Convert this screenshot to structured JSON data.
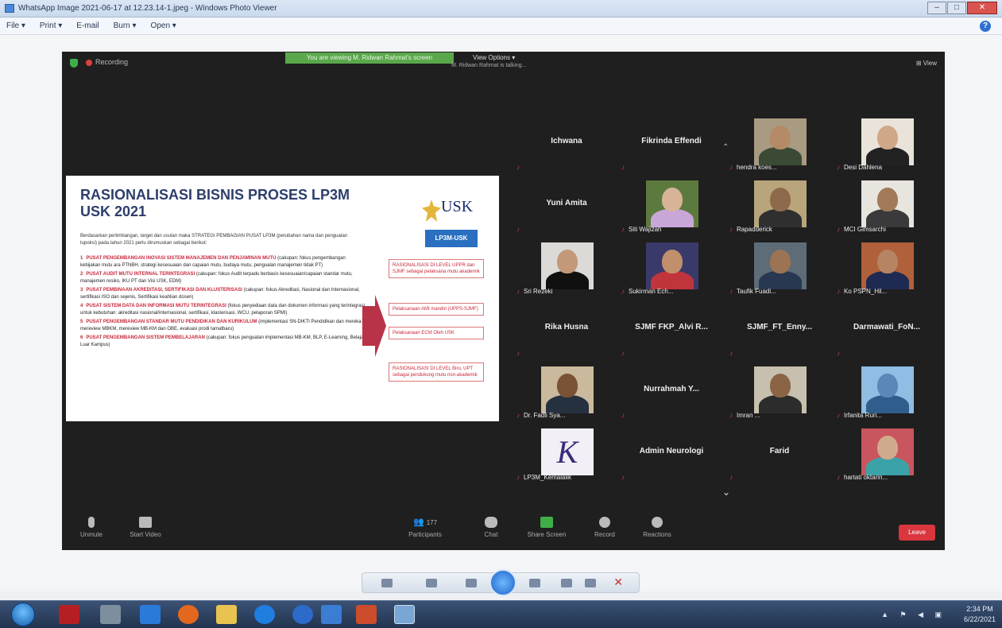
{
  "window": {
    "title": "WhatsApp Image 2021-06-17 at 12.23.14-1.jpeg - Windows Photo Viewer",
    "menu": [
      "File ▾",
      "Print ▾",
      "E-mail",
      "Burn ▾",
      "Open ▾"
    ],
    "help": "?"
  },
  "zoom": {
    "recording_label": "Recording",
    "viewing_banner": "You are viewing M. Ridwan Rahmat's screen",
    "view_options": "View Options ▾",
    "talking": "M. Ridwan Rahmat is talking...",
    "view_button": "View",
    "slide": {
      "title": "RASIONALISASI BISNIS PROSES LP3M USK 2021",
      "logo_text": "USK",
      "badge": "LP3M-USK",
      "intro": "Berdasarkan pertimbangan, target dan usulan maka STRATEGI PEMBAGIAN PUSAT LP3M (perubahan nama dan penguatan tupoksi) pada tahun 2021 perlu dirumuskan sebagai berikut:",
      "items": [
        {
          "num": "1",
          "head": "PUSAT PENGEMBANGAN INOVASI SISTEM MANAJEMEN DAN PENJAMINAN MUTU",
          "body": "(cakupan: fokus pengembangan kebijakan mutu ara PTNBH, strategi kesesuaian dan capaian mutu, budaya mutu, pengualan manajemen tidak PT)"
        },
        {
          "num": "2",
          "head": "PUSAT AUDIT MUTU INTERNAL TERINTEGRASI",
          "body": "(cakupan: fokus Audit terpadu berbasis kesesuaian/capaian standar mutu, manajemen resiko, IKU PT dan Visi USK, EDM)"
        },
        {
          "num": "3",
          "head": "PUSAT PEMBINAAN AKREDITASI, SERTIFIKASI DAN KLUSTERISASI",
          "body": "(cakupan: fokus Akreditasi, Nasional dan Internasional, sertifikasi ISO dan sejenis, Sertifikasi keahlian dosen)"
        },
        {
          "num": "4",
          "head": "PUSAT SISTEM DATA DAN INFORMASI MUTU TERINTEGRASI",
          "body": "(fokus penyediaan data dan dokumen informasi yang terintegrasi untuk kebutuhan: akreditasi nasional/internasional, sertifikasi, klasterisasi, WCU, pelaporan SPMI)"
        },
        {
          "num": "5",
          "head": "PUSAT PENGEMBANGAN STANDAR MUTU PENDIDIKAN DAN KURIKULUM",
          "body": "(implementasi SN-DIKTI Pendidikan dan mereka: mereview MBKM, mereview MB-KM dan OBE, evaluasi prodi tamatbaru)"
        },
        {
          "num": "6",
          "head": "PUSAT PENGEMBANGAN SISTEM PEMBELAJARAN",
          "body": "(cakupan: fokus penguatan implementasi MB-KM, BLP, E-Learning, Belajar Luar Kampus)"
        }
      ],
      "side_boxes": [
        "RASIONALISASI DI LEVEL UPPR dan SJMF sebagai pelaksana mutu akademik",
        "Pelaksanaan AMI mandiri (UPPS-SJMF)",
        "Pelaksanaan ECM Oleh USK",
        "RASIONALISASI DI LEVEL Biro, UPT sebagai pendukung mutu non-akademik"
      ]
    },
    "participants": [
      {
        "name": "Ichwana",
        "photo": false,
        "col": 0,
        "row": 0
      },
      {
        "name": "Fikrinda Effendi",
        "photo": false,
        "col": 1,
        "row": 0
      },
      {
        "name": "hendra koes...",
        "photo": true,
        "col": 2,
        "row": 0,
        "skin": "#b58a66",
        "cloth": "#3b4a35",
        "bg": "#a99a82"
      },
      {
        "name": "Desi Dahlena",
        "photo": true,
        "col": 3,
        "row": 0,
        "skin": "#d0a887",
        "cloth": "#222",
        "bg": "#e9e3d9"
      },
      {
        "name": "Yuni Amita",
        "photo": false,
        "col": 0,
        "row": 1
      },
      {
        "name": "Siti Wajizah",
        "photo": true,
        "col": 1,
        "row": 1,
        "skin": "#d7b398",
        "cloth": "#c9a6d8",
        "bg": "#5d7a3e"
      },
      {
        "name": "Rapadderick",
        "photo": true,
        "col": 2,
        "row": 1,
        "skin": "#8e6a4c",
        "cloth": "#2f2f2f",
        "bg": "#b9a57c"
      },
      {
        "name": "MCI Gimsarchi",
        "photo": true,
        "col": 3,
        "row": 1,
        "skin": "#a27a58",
        "cloth": "#3a3a3a",
        "bg": "#e8e4de"
      },
      {
        "name": "Sri Rezeki",
        "photo": true,
        "col": 0,
        "row": 2,
        "skin": "#c39979",
        "cloth": "#101010",
        "bg": "#dcdad6"
      },
      {
        "name": "Sukirman Ech...",
        "photo": true,
        "col": 1,
        "row": 2,
        "skin": "#c08f6c",
        "cloth": "#c0343c",
        "bg": "#3a3a6a"
      },
      {
        "name": "Taufik Fuadi...",
        "photo": true,
        "col": 2,
        "row": 2,
        "skin": "#9c7453",
        "cloth": "#283850",
        "bg": "#5e6c78"
      },
      {
        "name": "Ko PSPN_Hil...",
        "photo": true,
        "col": 3,
        "row": 2,
        "skin": "#b68462",
        "cloth": "#1e2a52",
        "bg": "#b0603a"
      },
      {
        "name": "Rika Husna",
        "photo": false,
        "col": 0,
        "row": 3
      },
      {
        "name": "SJMF FKP_Alvi R...",
        "photo": false,
        "col": 1,
        "row": 3
      },
      {
        "name": "SJMF_FT_Enny...",
        "photo": false,
        "col": 2,
        "row": 3
      },
      {
        "name": "Darmawati_FoN...",
        "photo": false,
        "col": 3,
        "row": 3
      },
      {
        "name": "Dr. Fadli Sya...",
        "photo": true,
        "col": 0,
        "row": 4,
        "skin": "#7a5236",
        "cloth": "#263140",
        "bg": "#cab99c"
      },
      {
        "name": "Nurrahmah Y...",
        "photo": false,
        "col": 1,
        "row": 4
      },
      {
        "name": "Imran ...",
        "photo": true,
        "col": 2,
        "row": 4,
        "skin": "#8b6446",
        "cloth": "#2c2c2c",
        "bg": "#c7c0ae"
      },
      {
        "name": "Irfanita Ruri...",
        "photo": true,
        "col": 3,
        "row": 4,
        "skin": "#5a87b8",
        "cloth": "#2f5e8c",
        "bg": "#8fbde3"
      },
      {
        "name": "LP3M_Kemalalik",
        "photo": true,
        "col": 0,
        "row": 5,
        "skin": "#ffffff",
        "cloth": "#ffffff",
        "bg": "#f2f0f6",
        "letter": "K"
      },
      {
        "name": "Admin Neurologi",
        "photo": false,
        "col": 1,
        "row": 5
      },
      {
        "name": "Farid",
        "photo": false,
        "col": 2,
        "row": 5
      },
      {
        "name": "hartati oktarin...",
        "photo": true,
        "col": 3,
        "row": 5,
        "skin": "#d0aa8c",
        "cloth": "#3ba3a8",
        "bg": "#c9555e"
      }
    ],
    "toolbar": {
      "unmute": "Unmute",
      "start_video": "Start Video",
      "participants": "Participants",
      "participants_count": "177",
      "chat": "Chat",
      "share_screen": "Share Screen",
      "record": "Record",
      "reactions": "Reactions",
      "leave": "Leave"
    }
  },
  "taskbar": {
    "time": "2:34 PM",
    "date": "6/22/2021"
  }
}
